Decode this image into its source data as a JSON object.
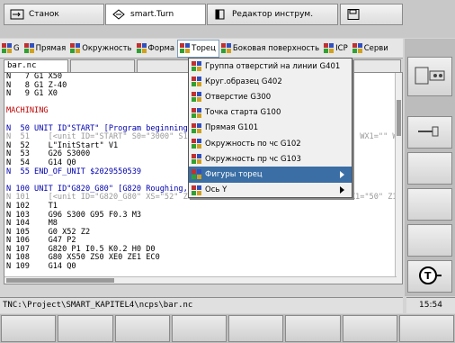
{
  "top_tabs": [
    {
      "label": "Станок"
    },
    {
      "label": "smart.Turn"
    },
    {
      "label": "Редактор инструм."
    }
  ],
  "menu": [
    {
      "label": "G"
    },
    {
      "label": "Прямая"
    },
    {
      "label": "Окружность"
    },
    {
      "label": "Форма"
    },
    {
      "label": "Торец"
    },
    {
      "label": "Боковая поверхность"
    },
    {
      "label": "ICP"
    },
    {
      "label": "Серви"
    }
  ],
  "file_tabs": [
    {
      "label": "bar.nc"
    },
    {
      "label": ""
    },
    {
      "label": ""
    },
    {
      "label": ""
    },
    {
      "label": ""
    },
    {
      "label": ""
    }
  ],
  "code_lines": [
    {
      "text": "N   7 G1 X50",
      "style": ""
    },
    {
      "text": "N   8 G1 Z-40",
      "style": ""
    },
    {
      "text": "N   9 G1 X0",
      "style": ""
    },
    {
      "text": "",
      "style": ""
    },
    {
      "text": "MACHINING",
      "style": "c-red"
    },
    {
      "text": "",
      "style": ""
    },
    {
      "text": "N  50 UNIT ID\"START\" [Program beginning]",
      "style": "c-blue"
    },
    {
      "text": "N  51    [<unit ID=\"START\" S0=\"3000\" S1=\"                                 \" WX1=\"\" W",
      "style": "c-gray"
    },
    {
      "text": "N  52    L\"InitStart\" V1",
      "style": ""
    },
    {
      "text": "N  53    G26 S3000",
      "style": ""
    },
    {
      "text": "N  54    G14 Q0",
      "style": ""
    },
    {
      "text": "N  55 END_OF_UNIT $2029550539",
      "style": "c-blue"
    },
    {
      "text": "",
      "style": ""
    },
    {
      "text": "N 100 UNIT ID\"G820_G80\" [G820 Roughing, direct transverse]",
      "style": "c-blue"
    },
    {
      "text": "N 101    [<unit ID=\"G820_G80\" XS=\"52\" ZS=\"2\" T=\"1\" TID=\"\" F=\"0.3\" S=\"300\" X1=\"50\" Z1=\"0",
      "style": "c-gray"
    },
    {
      "text": "N 102    T1",
      "style": ""
    },
    {
      "text": "N 103    G96 S300 G95 F0.3 M3",
      "style": ""
    },
    {
      "text": "N 104    M8",
      "style": ""
    },
    {
      "text": "N 105    G0 X52 Z2",
      "style": ""
    },
    {
      "text": "N 106    G47 P2",
      "style": ""
    },
    {
      "text": "N 107    G820 P1 I0.5 K0.2 H0 D0",
      "style": ""
    },
    {
      "text": "N 108    G80 XS50 ZS0 XE0 ZE1 EC0",
      "style": ""
    },
    {
      "text": "N 109    G14 Q0",
      "style": ""
    }
  ],
  "dropdown": [
    {
      "label": "Группа отверстий на линии G401",
      "submenu": false
    },
    {
      "label": "Круг.образец G402",
      "submenu": false
    },
    {
      "label": "Отверстие   G300",
      "submenu": false
    },
    {
      "label": "Точка старта G100",
      "submenu": false
    },
    {
      "label": "Прямая       G101",
      "submenu": false
    },
    {
      "label": "Окружность по чс  G102",
      "submenu": false
    },
    {
      "label": "Окружность  пр чс  G103",
      "submenu": false
    },
    {
      "label": "Фигуры торец",
      "submenu": true,
      "selected": true
    },
    {
      "label": "Ось Y",
      "submenu": true
    }
  ],
  "path": "TNC:\\Project\\SMART_KAPITEL4\\ncps\\bar.nc",
  "clock": "15:54",
  "colors": {
    "menu_select": "#3a6ea5",
    "keyword": "#c00000",
    "unit": "#0000b0",
    "comment": "#9a9a9a"
  },
  "icons": {
    "machine": "machine-icon",
    "smart": "smart-turn-icon",
    "tool": "tool-editor-icon",
    "save": "save-icon"
  }
}
